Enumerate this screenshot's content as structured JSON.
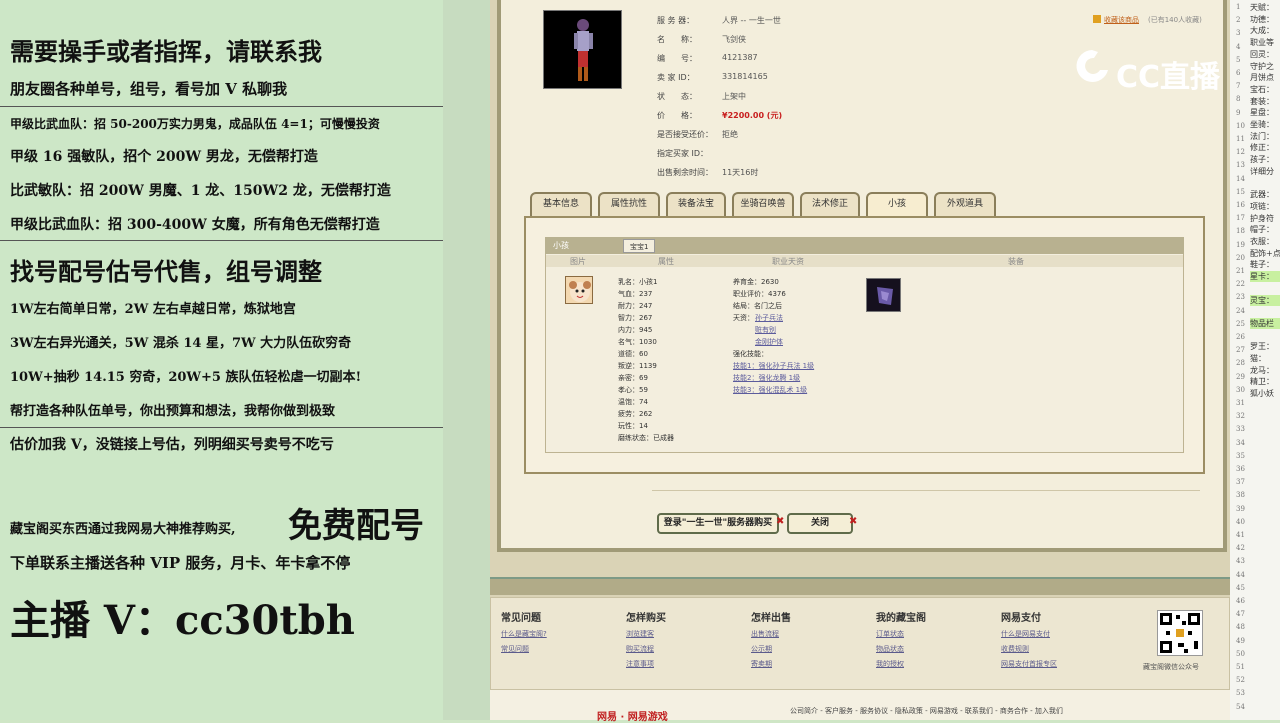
{
  "left": {
    "lines": [
      "需要操手或者指挥，请联系我",
      "朋友圈各种单号，组号，看号加 V 私聊我",
      "甲级比武血队：招 50-200万实力男鬼，成品队伍 4=1；可慢慢投资",
      "甲级 16 强敏队，招个 200W 男龙，无偿帮打造",
      "比武敏队：招 200W 男魔、1 龙、150W2 龙，无偿帮打造",
      "甲级比武血队：招 300-400W 女魔，所有角色无偿帮打造",
      "找号配号估号代售，组号调整",
      "1W左右简单日常，2W 左右卓越日常，炼狱地宫",
      "3W左右异光通关，5W 混杀 14 星，7W 大力队伍砍穷奇",
      "10W+抽秒 14.15 穷奇，20W+5 族队伍轻松虐一切副本!",
      "帮打造各种队伍单号，你出预算和想法，我帮你做到极致",
      "估价加我 V，没链接上号估，列明细买号卖号不吃亏"
    ],
    "promo_small": "藏宝阁买东西通过我网易大神推荐购买,",
    "promo_big": "免费配号",
    "vip": "下单联系主播送各种 VIP 服务，月卡、年卡拿不停",
    "anchor": "主播 V：cc30tbh"
  },
  "watermark": "CC直播",
  "info": {
    "rows": [
      {
        "label": "服 务 器：",
        "value": "人界 -- 一生一世"
      },
      {
        "label": "名　　称：",
        "value": "飞剑侠"
      },
      {
        "label": "编　　号：",
        "value": "4121387"
      },
      {
        "label": "卖 家 ID：",
        "value": "331814165"
      },
      {
        "label": "状　　态：",
        "value": "上架中"
      },
      {
        "label": "价　　格：",
        "value": "¥2200.00 (元)"
      },
      {
        "label": "是否接受还价：",
        "value": "拒绝"
      },
      {
        "label": "指定买家 ID：",
        "value": ""
      },
      {
        "label": "出售剩余时间：",
        "value": "11天16时"
      }
    ],
    "fav_link": "收藏该商品",
    "fav_count": "(已有140人收藏)"
  },
  "tabs": [
    "基本信息",
    "属性抗性",
    "装备法宝",
    "坐骑召唤兽",
    "法术修正",
    "小孩",
    "外观道具"
  ],
  "panel": {
    "header": "小孩",
    "subtab": "宝宝1",
    "cols": [
      "图片",
      "属性",
      "职业天资",
      "",
      "装备"
    ],
    "attrs": [
      "乳名：小孩1",
      "气血：237",
      "耐力：247",
      "智力：267",
      "内力：945",
      "名气：1030",
      "道德：60",
      "叛逆：1139",
      "亲密：69",
      "孝心：59",
      "温饱：74",
      "疲劳：262",
      "玩性：14",
      "磨练状态：已成器"
    ],
    "pro": [
      "养育金：2630",
      "职业评价：4376",
      "结局：名门之后",
      "天资："
    ],
    "talents": [
      "孙子兵法",
      "赃有别",
      "金刚护体"
    ],
    "skill_label": "强化技能：",
    "skills": [
      "技能1：强化孙子兵法 1级",
      "技能2：强化龙腾 1级",
      "技能3：强化混乱术 1级"
    ]
  },
  "buttons": {
    "buy": "登录\"一生一世\"服务器购买",
    "close": "关闭"
  },
  "footer": {
    "cols": [
      {
        "title": "常见问题",
        "links": [
          "什么是藏宝阁?",
          "常见问题"
        ]
      },
      {
        "title": "怎样购买",
        "links": [
          "浏览建客",
          "购买流程",
          "注意事项"
        ]
      },
      {
        "title": "怎样出售",
        "links": [
          "出售流程",
          "公示期",
          "寄卖期"
        ]
      },
      {
        "title": "我的藏宝阁",
        "links": [
          "订单状态",
          "物品状态",
          "我的授权"
        ]
      },
      {
        "title": "网易支付",
        "links": [
          "什么是网易支付",
          "收费规则",
          "网易支付首报专区"
        ]
      }
    ],
    "qr_caption": "藏宝阁微信公众号",
    "bottom_links": "公司简介 - 客户服务 - 服务协议 - 隐私政策 - 网易游戏 - 联系我们 - 商务合作 - 加入我们",
    "logo_text": "网易 · 网易游戏"
  },
  "right_labels": [
    "天赋：",
    "功德：",
    "大成：",
    "职业等",
    "回灵：",
    "守护之",
    "月饼点",
    "宝石：",
    "套装：",
    "星盘：",
    "坐骑：",
    "法门：",
    "修正：",
    "孩子：",
    "详细分",
    "武器：",
    "项链：",
    "护身符",
    "帽子：",
    "衣服：",
    "配饰+点",
    "鞋子：",
    "星卡：",
    "灵宝：",
    "物品栏",
    "罗王：",
    "猫：",
    "龙马：",
    "精卫：",
    "狐小妖"
  ],
  "row_numbers": [
    "1",
    "2",
    "3",
    "4",
    "5",
    "6",
    "7",
    "8",
    "9",
    "10",
    "11",
    "12",
    "13",
    "14",
    "15",
    "16",
    "17",
    "18",
    "19",
    "20",
    "21",
    "22",
    "23",
    "24",
    "25",
    "26",
    "27",
    "28",
    "29",
    "30",
    "31",
    "32",
    "33",
    "34",
    "35",
    "36",
    "37",
    "38",
    "39",
    "40",
    "41",
    "42",
    "43",
    "44",
    "45",
    "46",
    "47",
    "48",
    "49",
    "50",
    "51",
    "52",
    "53",
    "54"
  ],
  "colors": {
    "bg_left": "#cde7c7",
    "price": "#c81e1e",
    "highlight": "#c8f0a0"
  }
}
